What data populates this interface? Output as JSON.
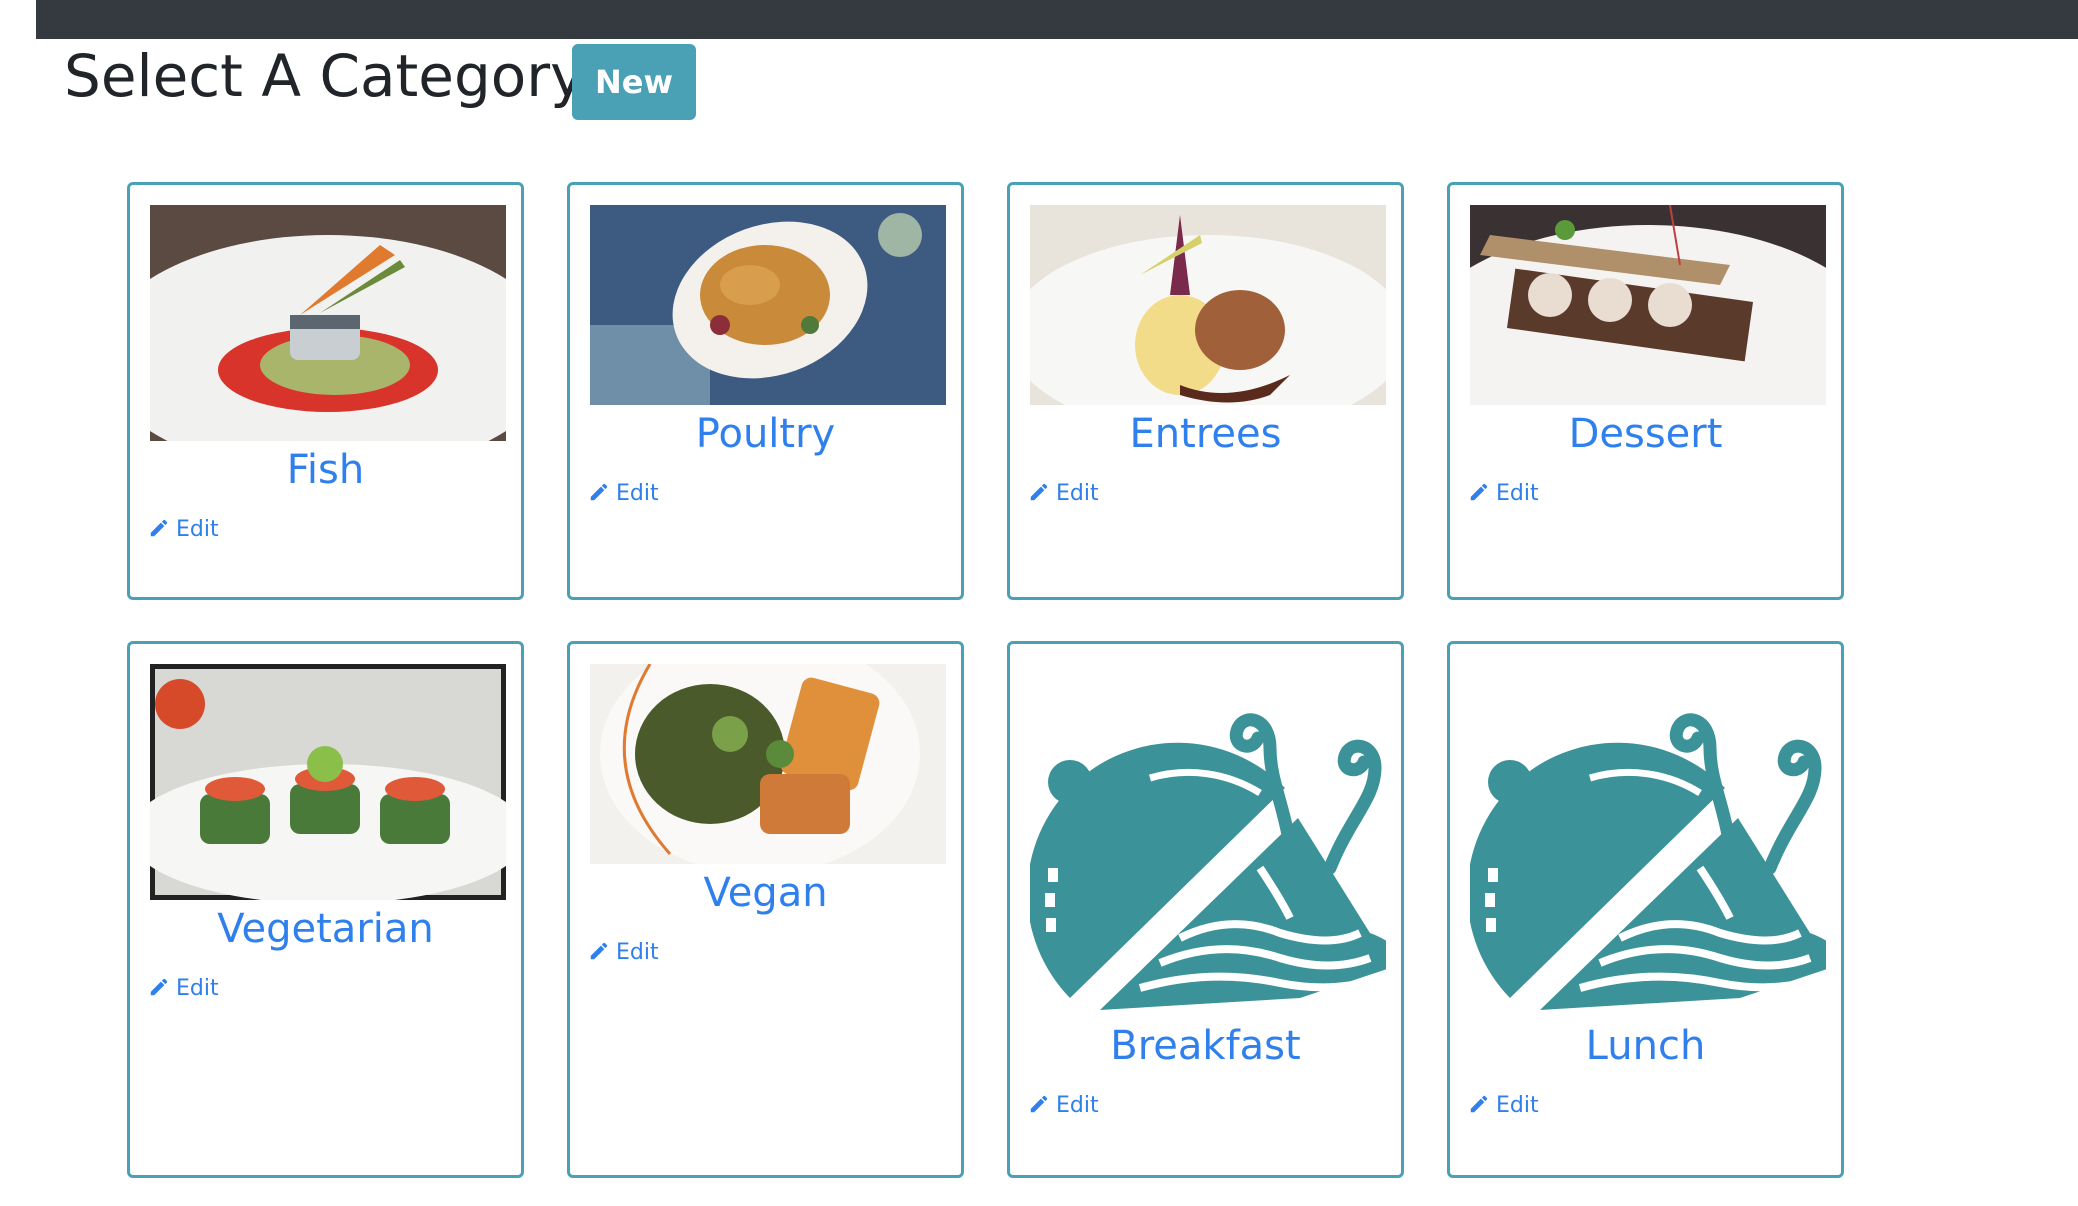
{
  "header": {
    "title": "Select A Category",
    "new_label": "New"
  },
  "colors": {
    "topbar": "#343a40",
    "accent": "#4aa0b5",
    "link": "#2f80ed",
    "placeholder_icon": "#3b9298"
  },
  "categories": [
    {
      "name": "Fish",
      "edit_label": "Edit",
      "image": "photo-fish"
    },
    {
      "name": "Poultry",
      "edit_label": "Edit",
      "image": "photo-poultry"
    },
    {
      "name": "Entrees",
      "edit_label": "Edit",
      "image": "photo-entrees"
    },
    {
      "name": "Dessert",
      "edit_label": "Edit",
      "image": "photo-dessert"
    },
    {
      "name": "Vegetarian",
      "edit_label": "Edit",
      "image": "photo-vegetarian"
    },
    {
      "name": "Vegan",
      "edit_label": "Edit",
      "image": "photo-vegan"
    },
    {
      "name": "Breakfast",
      "edit_label": "Edit",
      "image": "cloche-icon"
    },
    {
      "name": "Lunch",
      "edit_label": "Edit",
      "image": "cloche-icon"
    }
  ]
}
